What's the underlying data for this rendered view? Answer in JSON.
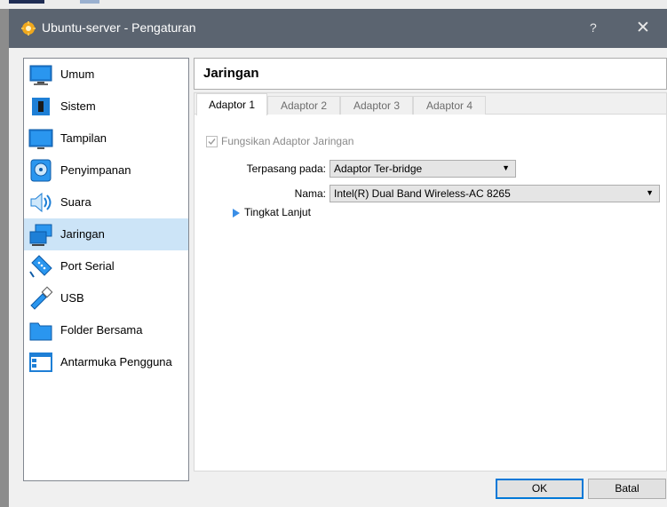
{
  "window": {
    "title": "Ubuntu-server - Pengaturan",
    "help": "?",
    "close": "✕"
  },
  "sidebar": {
    "items": [
      {
        "label": "Umum",
        "icon": "monitor-icon"
      },
      {
        "label": "Sistem",
        "icon": "chip-icon"
      },
      {
        "label": "Tampilan",
        "icon": "display-icon"
      },
      {
        "label": "Penyimpanan",
        "icon": "storage-icon"
      },
      {
        "label": "Suara",
        "icon": "speaker-icon"
      },
      {
        "label": "Jaringan",
        "icon": "network-icon",
        "selected": true
      },
      {
        "label": "Port Serial",
        "icon": "serial-port-icon"
      },
      {
        "label": "USB",
        "icon": "usb-icon"
      },
      {
        "label": "Folder Bersama",
        "icon": "folder-icon"
      },
      {
        "label": "Antarmuka Pengguna",
        "icon": "ui-window-icon"
      }
    ]
  },
  "header": {
    "title": "Jaringan"
  },
  "tabs": [
    {
      "label": "Adaptor 1",
      "active": true
    },
    {
      "label": "Adaptor 2"
    },
    {
      "label": "Adaptor 3"
    },
    {
      "label": "Adaptor 4"
    }
  ],
  "adapter": {
    "enable_label": "Fungsikan Adaptor Jaringan",
    "enabled": true,
    "attached_label": "Terpasang pada:",
    "attached_value": "Adaptor Ter-bridge",
    "name_label": "Nama:",
    "name_value": "Intel(R) Dual Band Wireless-AC 8265",
    "advanced_label": "Tingkat Lanjut"
  },
  "buttons": {
    "ok": "OK",
    "cancel": "Batal"
  },
  "colors": {
    "titlebar": "#5b6470",
    "selection": "#cce4f7",
    "accent": "#0078d7"
  }
}
